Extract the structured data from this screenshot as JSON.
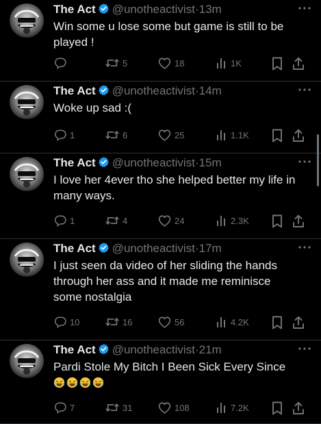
{
  "colors": {
    "background": "#000000",
    "text": "#e7e9ea",
    "muted": "#71767b",
    "verified": "#1d9bf0",
    "divider": "#2f3336"
  },
  "tweets": [
    {
      "name": "The Act",
      "handle": "@unotheactivist",
      "separator": "·",
      "time": "13m",
      "lines": [
        "Win some u lose some but game is still to be",
        "played !"
      ],
      "emojis": [],
      "reply_count": "",
      "retweet_count": "5",
      "like_count": "18",
      "view_count": "1K"
    },
    {
      "name": "The Act",
      "handle": "@unotheactivist",
      "separator": "·",
      "time": "14m",
      "lines": [
        "Woke up sad :("
      ],
      "emojis": [],
      "reply_count": "1",
      "retweet_count": "6",
      "like_count": "25",
      "view_count": "1.1K"
    },
    {
      "name": "The Act",
      "handle": "@unotheactivist",
      "separator": "·",
      "time": "15m",
      "lines": [
        "I love her 4ever tho she helped better my life in",
        "many ways."
      ],
      "emojis": [],
      "reply_count": "1",
      "retweet_count": "4",
      "like_count": "24",
      "view_count": "2.3K"
    },
    {
      "name": "The Act",
      "handle": "@unotheactivist",
      "separator": "·",
      "time": "17m",
      "lines": [
        "I just seen da video of her sliding the hands",
        "through her ass and it made me reminisce",
        "some nostalgia"
      ],
      "emojis": [],
      "reply_count": "10",
      "retweet_count": "16",
      "like_count": "56",
      "view_count": "4.2K"
    },
    {
      "name": "The Act",
      "handle": "@unotheactivist",
      "separator": "·",
      "time": "21m",
      "lines": [
        "Pardi Stole My Bitch I Been Sick Every Since"
      ],
      "emojis": [
        "rolling-on-floor-laughing",
        "rolling-on-floor-laughing",
        "rolling-on-floor-laughing",
        "rolling-on-floor-laughing"
      ],
      "reply_count": "7",
      "retweet_count": "31",
      "like_count": "108",
      "view_count": "7.2K"
    }
  ],
  "icons": {
    "more": "more-horizontal-icon",
    "reply": "reply-icon",
    "retweet": "retweet-icon",
    "like": "heart-icon",
    "views": "views-icon",
    "bookmark": "bookmark-icon",
    "share": "share-icon",
    "verified": "verified-badge-icon"
  }
}
